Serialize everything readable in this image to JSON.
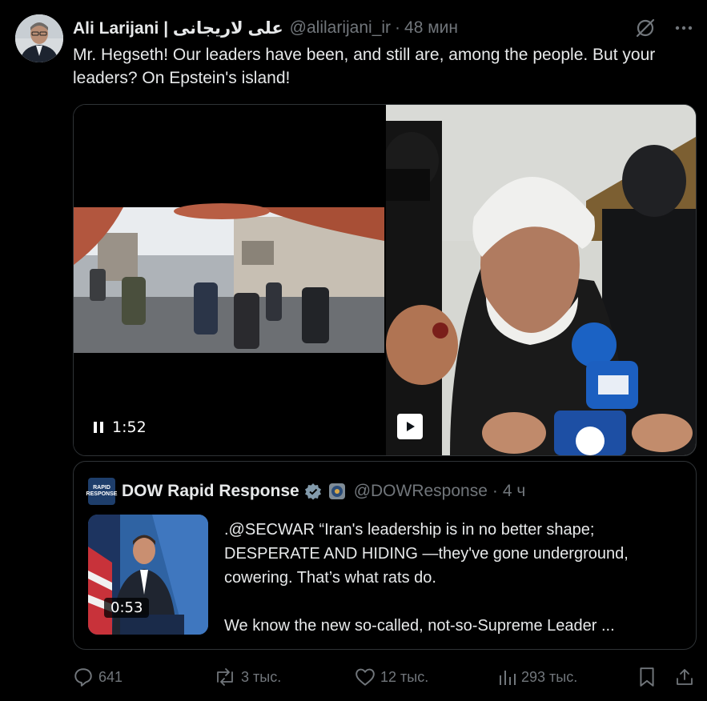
{
  "author": {
    "name": "Ali Larijani | علی لاریجانی",
    "handle": "@alilarijani_ir",
    "separator": "·",
    "time": "48 мин"
  },
  "tweet": {
    "text": "Mr. Hegseth! Our leaders have been, and still are, among the people. But your leaders? On Epstein's island!"
  },
  "media": {
    "video1_duration": "1:52"
  },
  "quoted": {
    "logo_line1": "RAPID",
    "logo_line2": "RESPONSE",
    "name": "DOW Rapid Response",
    "handle": "@DOWResponse",
    "separator": "·",
    "time": "4 ч",
    "video_duration": "0:53",
    "text_p1": ".@SECWAR “Iran's leadership is in no better shape; DESPERATE AND HIDING —they've gone underground, cowering. That’s what rats do.",
    "text_p2": "We know the new so-called, not-so-Supreme Leader ..."
  },
  "actions": {
    "replies": "641",
    "reposts": "3 тыс.",
    "likes": "12 тыс.",
    "views": "293 тыс."
  },
  "colors": {
    "background": "#000000",
    "text": "#e7e9ea",
    "secondary": "#71767b",
    "border": "#2f3336",
    "verified": "#829aab"
  }
}
